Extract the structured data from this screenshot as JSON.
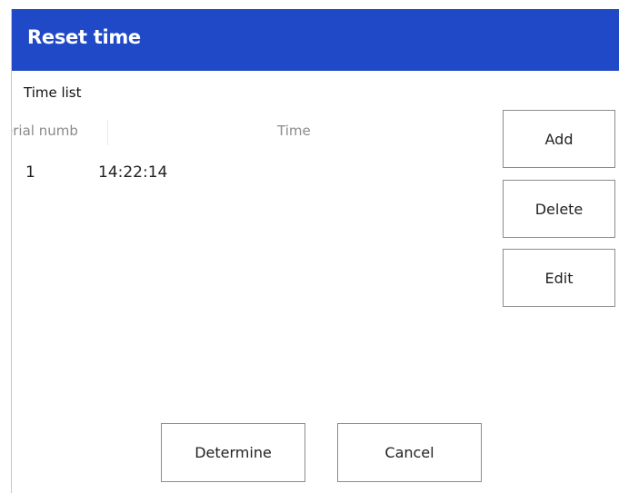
{
  "dialog": {
    "title": "Reset time",
    "group_label": "Time list"
  },
  "time_list": {
    "columns": [
      "Serial number",
      "Time"
    ],
    "serial_header_visible": "erial numb",
    "rows": [
      {
        "serial": "1",
        "time": "14:22:14"
      }
    ]
  },
  "actions": {
    "add": "Add",
    "delete": "Delete",
    "edit": "Edit"
  },
  "footer": {
    "determine": "Determine",
    "cancel": "Cancel"
  },
  "colors": {
    "titlebar": "#1f49c7",
    "title_text": "#ffffff",
    "button_border": "#8c8c8c"
  }
}
